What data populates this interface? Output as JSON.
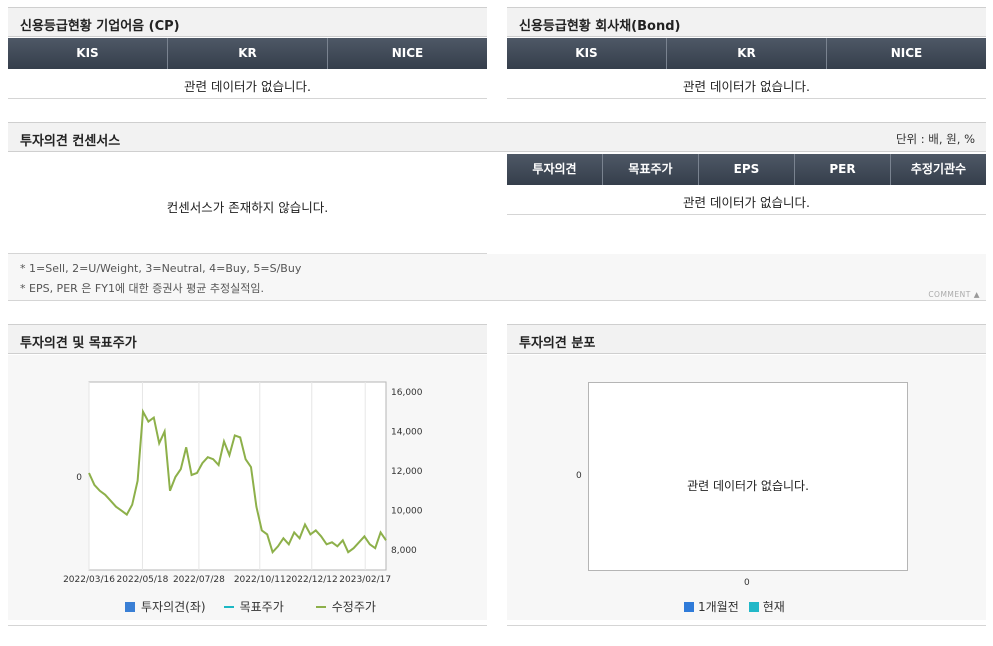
{
  "credit_cp": {
    "title": "신용등급현황 기업어음 (CP)",
    "columns": [
      "KIS",
      "KR",
      "NICE"
    ],
    "empty": "관련 데이터가 없습니다."
  },
  "credit_bond": {
    "title": "신용등급현황 회사채(Bond)",
    "columns": [
      "KIS",
      "KR",
      "NICE"
    ],
    "empty": "관련 데이터가 없습니다."
  },
  "consensus": {
    "title": "투자의견 컨센서스",
    "unit": "단위 : 배, 원, %",
    "left_empty": "컨센서스가 존재하지 않습니다.",
    "columns": [
      "투자의견",
      "목표주가",
      "EPS",
      "PER",
      "추정기관수"
    ],
    "right_empty": "관련 데이터가 없습니다.",
    "notes": [
      "* 1=Sell, 2=U/Weight, 3=Neutral, 4=Buy, 5=S/Buy",
      "* EPS, PER 은 FY1에 대한 증권사 평균 추정실적임."
    ],
    "comment_label": "COMMENT"
  },
  "opinion_target": {
    "title": "투자의견 및 목표주가",
    "left_axis_ticks": [
      "0"
    ],
    "right_axis_ticks": [
      "16,000",
      "14,000",
      "12,000",
      "10,000",
      "8,000"
    ],
    "x_ticks": [
      "2022/03/16",
      "2022/05/18",
      "2022/07/28",
      "2022/10/11",
      "2022/12/12",
      "2023/02/17"
    ],
    "legend": {
      "opinion": "투자의견(좌)",
      "target": "목표주가",
      "price": "수정주가"
    }
  },
  "distribution": {
    "title": "투자의견 분포",
    "empty": "관련 데이터가 없습니다.",
    "y_tick": "0",
    "x_tick": "0",
    "legend": {
      "prev": "1개월전",
      "now": "현재"
    }
  },
  "colors": {
    "opinion": "#3a7fd5",
    "target": "#1cb8c4",
    "price": "#8db04a",
    "prev": "#2f7bd9",
    "now": "#22b8c8"
  },
  "chart_data": {
    "type": "line",
    "title": "투자의견 및 목표주가",
    "x": [
      "2022/03/16",
      "2022/05/18",
      "2022/07/28",
      "2022/10/11",
      "2022/12/12",
      "2023/02/17"
    ],
    "ylim_right": [
      7000,
      16500
    ],
    "series": [
      {
        "name": "수정주가",
        "values": [
          11900,
          11300,
          11000,
          10800,
          10500,
          10200,
          10000,
          9800,
          10300,
          11500,
          15000,
          14500,
          14700,
          13400,
          14000,
          11000,
          11700,
          12100,
          13200,
          11800,
          11900,
          12400,
          12700,
          12600,
          12300,
          13500,
          12800,
          13800,
          13700,
          12600,
          12200,
          10200,
          9000,
          8800,
          7900,
          8200,
          8600,
          8300,
          8900,
          8600,
          9300,
          8800,
          9000,
          8700,
          8300,
          8400,
          8200,
          8500,
          7900,
          8100,
          8400,
          8700,
          8300,
          8100,
          8900,
          8500
        ]
      },
      {
        "name": "목표주가",
        "values": []
      },
      {
        "name": "투자의견(좌)",
        "values": []
      }
    ],
    "grid": true
  }
}
